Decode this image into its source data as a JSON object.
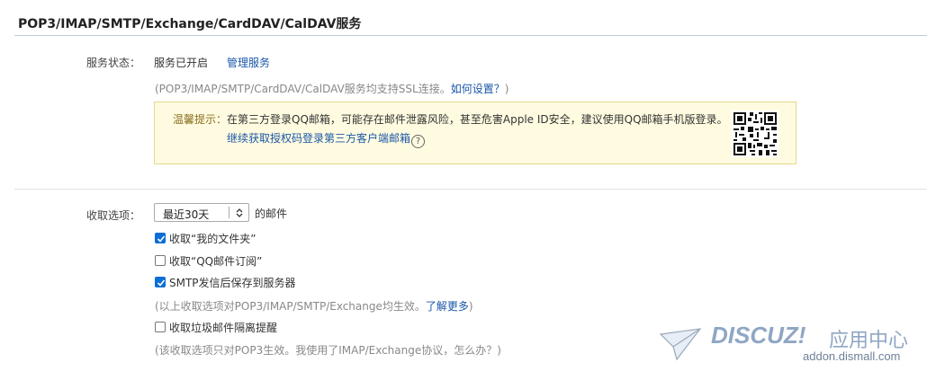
{
  "section_title": "POP3/IMAP/SMTP/Exchange/CardDAV/CalDAV服务",
  "service": {
    "label": "服务状态：",
    "status": "服务已开启",
    "manage_link": "管理服务",
    "note_prefix": "(POP3/IMAP/SMTP/CardDAV/CalDAV服务均支持SSL连接。",
    "note_link": "如何设置？",
    "note_suffix": ")"
  },
  "warning": {
    "label": "温馨提示：",
    "text": "在第三方登录QQ邮箱，可能存在邮件泄露风险，甚至危害Apple ID安全，建议使用QQ邮箱手机版登录。",
    "link": "继续获取授权码登录第三方客户端邮箱",
    "help_mark": "?"
  },
  "receive": {
    "label": "收取选项：",
    "range_selected": "最近30天",
    "range_suffix": "的邮件",
    "options": [
      {
        "label": "收取“我的文件夹”",
        "checked": true
      },
      {
        "label": "收取“QQ邮件订阅”",
        "checked": false
      },
      {
        "label": "SMTP发信后保存到服务器",
        "checked": true
      }
    ],
    "note1_prefix": "(以上收取选项对POP3/IMAP/SMTP/Exchange均生效。",
    "note1_link": "了解更多",
    "note1_suffix": ")",
    "spam_option": {
      "label": "收取垃圾邮件隔离提醒",
      "checked": false
    },
    "note2": "(该收取选项只对POP3生效。我使用了IMAP/Exchange协议，怎么办？)"
  },
  "watermark": {
    "brand": "DISCUZ!",
    "brand_cn": "应用中心",
    "domain": "addon.dismall.com"
  },
  "colors": {
    "link": "#1a57a8",
    "checkbox_checked": "#0b6ed6",
    "warning_bg": "#fffbe0",
    "warning_border": "#e6d78c"
  },
  "icons": {
    "qr": "qr-code-icon",
    "select_arrow": "updown-arrows-icon",
    "check": "checkmark-icon"
  }
}
